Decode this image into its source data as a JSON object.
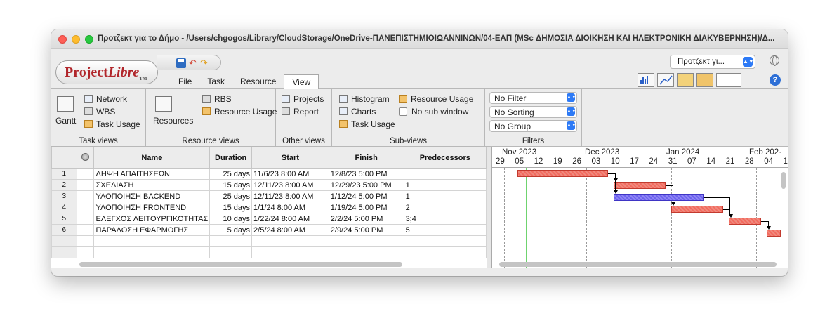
{
  "window": {
    "title": "Προτζεκτ για το Δήμο - /Users/chgogos/Library/CloudStorage/OneDrive-ΠΑΝΕΠΙΣΤΗΜΙΟΙΩΑΝΝΙΝΩΝ/04-ΕΑΠ (MSc ΔΗΜΟΣΙΑ ΔΙΟΙΚΗΣΗ ΚΑΙ ΗΛΕΚΤΡΟΝΙΚΗ ΔΙΑΚΥΒΕΡΝΗΣΗ)/Δ..."
  },
  "app": {
    "logo_main": "Project",
    "logo_accent": "Libre",
    "logo_tm": "TM"
  },
  "menu_tabs": [
    "File",
    "Task",
    "Resource",
    "View"
  ],
  "project_selector": "Προτζεκτ γι...",
  "ribbon": {
    "task_views": {
      "label": "Task views",
      "gantt": "Gantt",
      "network": "Network",
      "wbs": "WBS",
      "task_usage": "Task Usage"
    },
    "resource_views": {
      "label": "Resource views",
      "resources": "Resources",
      "rbs": "RBS",
      "resource_usage": "Resource Usage"
    },
    "other_views": {
      "label": "Other views",
      "projects": "Projects",
      "report": "Report"
    },
    "sub_views": {
      "label": "Sub-views",
      "histogram": "Histogram",
      "charts": "Charts",
      "task_usage": "Task Usage",
      "resource_usage": "Resource Usage",
      "no_sub_window": "No sub window"
    },
    "filters": {
      "label": "Filters",
      "filter": "No Filter",
      "sorting": "No Sorting",
      "group": "No Group"
    }
  },
  "table": {
    "headers": [
      "",
      "Name",
      "Duration",
      "Start",
      "Finish",
      "Predecessors"
    ],
    "rows": [
      {
        "id": "1",
        "name": "ΛΗΨΗ ΑΠΑΙΤΗΣΕΩΝ",
        "duration": "25 days",
        "start": "11/6/23 8:00 AM",
        "finish": "12/8/23 5:00 PM",
        "pred": ""
      },
      {
        "id": "2",
        "name": "ΣΧΕΔΙΑΣΗ",
        "duration": "15 days",
        "start": "12/11/23 8:00 AM",
        "finish": "12/29/23 5:00 PM",
        "pred": "1"
      },
      {
        "id": "3",
        "name": "ΥΛΟΠΟΙΗΣΗ BACKEND",
        "duration": "25 days",
        "start": "12/11/23 8:00 AM",
        "finish": "1/12/24 5:00 PM",
        "pred": "1"
      },
      {
        "id": "4",
        "name": "ΥΛΟΠΟΙΗΣΗ FRONTEND",
        "duration": "15 days",
        "start": "1/1/24 8:00 AM",
        "finish": "1/19/24 5:00 PM",
        "pred": "2"
      },
      {
        "id": "5",
        "name": "ΕΛΕΓΧΟΣ ΛΕΙΤΟΥΡΓΙΚΟΤΗΤΑΣ",
        "duration": "10 days",
        "start": "1/22/24 8:00 AM",
        "finish": "2/2/24 5:00 PM",
        "pred": "3;4"
      },
      {
        "id": "6",
        "name": "ΠΑΡΑΔΟΣΗ ΕΦΑΡΜΟΓΗΣ",
        "duration": "5 days",
        "start": "2/5/24 8:00 AM",
        "finish": "2/9/24 5:00 PM",
        "pred": "5"
      }
    ]
  },
  "gantt": {
    "months": [
      "Nov 2023",
      "Dec 2023",
      "Jan 2024",
      "Feb 202·"
    ],
    "days": [
      "29",
      "05",
      "12",
      "19",
      "26",
      "03",
      "10",
      "17",
      "24",
      "31",
      "07",
      "14",
      "21",
      "28",
      "04",
      "1"
    ],
    "tasks": [
      {
        "row": 1,
        "start": "2023-11-06",
        "end": "2023-12-08",
        "color": "#f26b5f"
      },
      {
        "row": 2,
        "start": "2023-12-11",
        "end": "2023-12-29",
        "color": "#f26b5f"
      },
      {
        "row": 3,
        "start": "2023-12-11",
        "end": "2024-01-12",
        "color": "#6c62ee"
      },
      {
        "row": 4,
        "start": "2024-01-01",
        "end": "2024-01-19",
        "color": "#f26b5f"
      },
      {
        "row": 5,
        "start": "2024-01-22",
        "end": "2024-02-02",
        "color": "#f26b5f"
      },
      {
        "row": 6,
        "start": "2024-02-05",
        "end": "2024-02-09",
        "color": "#f26b5f"
      }
    ],
    "today": "2023-11-09"
  }
}
